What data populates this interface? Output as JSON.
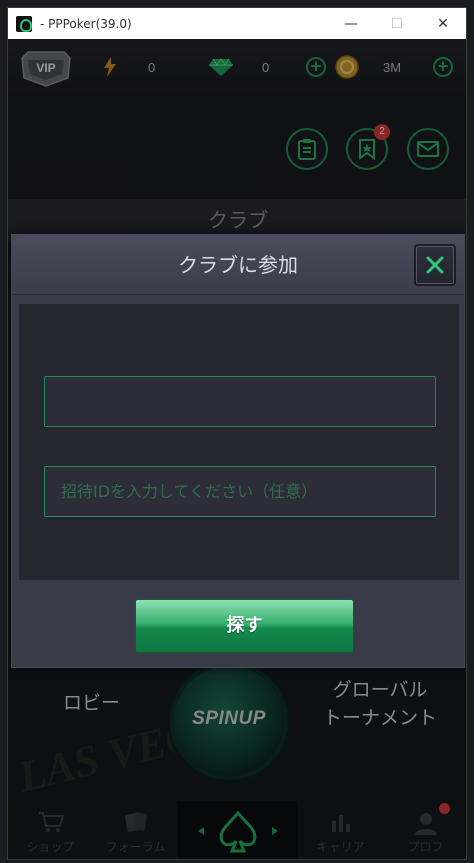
{
  "window": {
    "title": " - PPPoker(39.0)",
    "minimize": "—",
    "maximize": "☐",
    "close": "✕"
  },
  "topbar": {
    "vip_label": "VIP",
    "energy_value": "0",
    "diamond_value": "0",
    "coin_value": "3M",
    "plus": "+"
  },
  "notifications": {
    "badge_count": "2"
  },
  "club_header": "クラブ",
  "modal": {
    "title": "クラブに参加",
    "club_id_value": "",
    "invite_placeholder": "招待IDを入力してください（任意）",
    "search_button": "探す"
  },
  "hub": {
    "lobby": "ロビー",
    "spinup": "SPINUP",
    "global_line1": "グローバル",
    "global_line2": "トーナメント",
    "bg_text": "LAS VEGAS"
  },
  "bottom_nav": {
    "shop": "ショップ",
    "forum": "フォーラム",
    "career": "キャリア",
    "profile": "プロフ"
  },
  "colors": {
    "accent_green": "#1f9b57",
    "badge_red": "#d83a3a",
    "modal_bg": "#3a3b48"
  }
}
